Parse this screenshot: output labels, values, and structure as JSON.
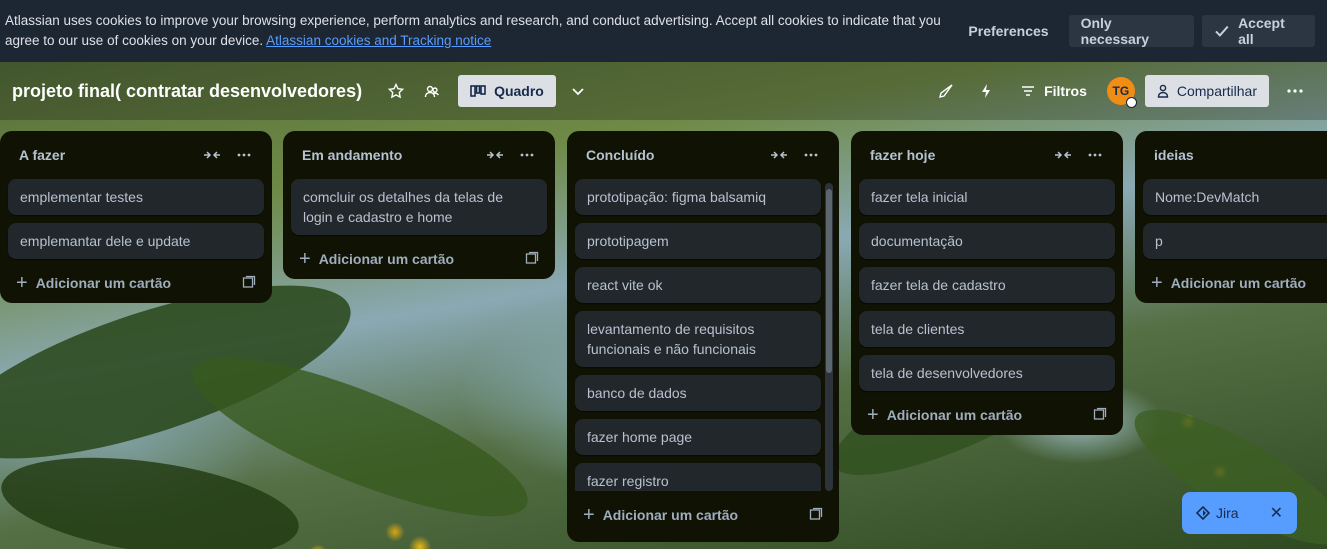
{
  "cookie_banner": {
    "text": "Atlassian uses cookies to improve your browsing experience, perform analytics and research, and conduct advertising. Accept all cookies to indicate that you agree to our use of cookies on your device.",
    "link": "Atlassian cookies and Tracking notice",
    "preferences": "Preferences",
    "only_necessary": "Only necessary",
    "accept_all": "Accept all"
  },
  "header": {
    "board_title": "projeto final( contratar desenvolvedores)",
    "view_label": "Quadro",
    "filter_label": "Filtros",
    "avatar_initials": "TG",
    "share_label": "Compartilhar"
  },
  "lists": [
    {
      "title": "A fazer",
      "cards": [
        "emplementar testes",
        "emplemantar dele e update"
      ],
      "add_label": "Adicionar um cartão"
    },
    {
      "title": "Em andamento",
      "cards": [
        "comcluir os detalhes da telas de login e cadastro e home"
      ],
      "add_label": "Adicionar um cartão"
    },
    {
      "title": "Concluído",
      "cards": [
        "prototipação: figma balsamiq",
        "prototipagem",
        "react vite ok",
        "levantamento de requisitos funcionais e não funcionais",
        "banco de dados",
        "fazer home page",
        "fazer registro"
      ],
      "add_label": "Adicionar um cartão"
    },
    {
      "title": "fazer hoje",
      "cards": [
        "fazer tela inicial",
        "documentação",
        "fazer tela de cadastro",
        "tela de clientes",
        "tela de desenvolvedores"
      ],
      "add_label": "Adicionar um cartão"
    },
    {
      "title": "ideias",
      "cards": [
        "Nome:DevMatch",
        "p"
      ],
      "add_label": "Adicionar um cartão"
    }
  ],
  "jira": {
    "label": "Jira"
  },
  "colors": {
    "list_bg": "#101204",
    "card_bg": "#22272b",
    "cookie_bg": "#1d2633",
    "link": "#579dff",
    "avatar": "#f18d13"
  }
}
